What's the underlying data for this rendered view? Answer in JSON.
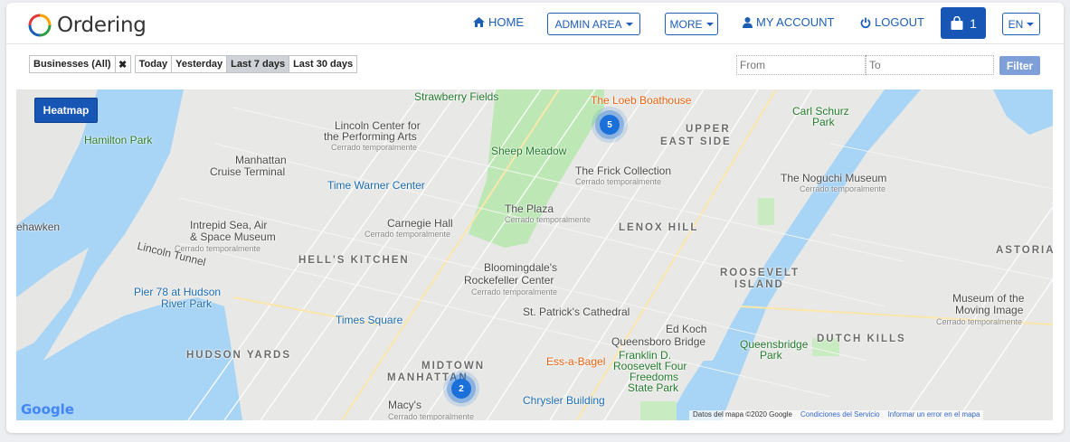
{
  "app": {
    "name": "Ordering"
  },
  "nav": {
    "home": "HOME",
    "admin": "ADMIN AREA",
    "more": "MORE",
    "account": "MY ACCOUNT",
    "logout": "LOGOUT",
    "cart_count": "1",
    "lang": "EN"
  },
  "filters": {
    "businesses": "Businesses (All)",
    "clear": "✖",
    "ranges": [
      "Today",
      "Yesterday",
      "Last 7 days",
      "Last 30 days"
    ],
    "active_range": "Last 7 days",
    "from_placeholder": "From",
    "to_placeholder": "To",
    "filter_button": "Filter"
  },
  "map": {
    "heatmap_button": "Heatmap",
    "clusters": [
      {
        "label": "5"
      },
      {
        "label": "2"
      }
    ],
    "labels": {
      "strawberry": "Strawberry Fields",
      "loeb": "The Loeb Boathouse",
      "carl": "Carl Schurz",
      "carl2": "Park",
      "upper": "UPPER",
      "eastside": "EAST SIDE",
      "lincoln1": "Lincoln Center for",
      "lincoln2": "the Performing Arts",
      "lincoln_sub": "Cerrado temporalmente",
      "hamilton": "Hamilton Park",
      "manhattan_cruise1": "Manhattan",
      "manhattan_cruise2": "Cruise Terminal",
      "sheep": "Sheep Meadow",
      "frick": "The Frick Collection",
      "frick_sub": "Cerrado temporalmente",
      "noguchi": "The Noguchi Museum",
      "noguchi_sub": "Cerrado temporalmente",
      "timewarner": "Time Warner Center",
      "plaza": "The Plaza",
      "plaza_sub": "Cerrado temporalmente",
      "lenox": "LENOX HILL",
      "weehawken": "ehawken",
      "intrepid1": "Intrepid Sea, Air",
      "intrepid2": "& Space Museum",
      "intrepid_sub": "Cerrado temporalmente",
      "carnegie": "Carnegie Hall",
      "carnegie_sub": "Cerrado temporalmente",
      "astoria": "ASTORIA",
      "hells": "HELL'S KITCHEN",
      "lincoln_tunnel": "Lincoln Tunnel",
      "bloomingdales": "Bloomingdale's",
      "roosevelt1": "ROOSEVELT",
      "roosevelt2": "ISLAND",
      "rockefeller": "Rockefeller Center",
      "rockefeller_sub": "Cerrado temporalmente",
      "pier78a": "Pier 78 at Hudson",
      "pier78b": "River Park",
      "stpatricks": "St. Patrick's Cathedral",
      "museum_moving1": "Museum of the",
      "museum_moving2": "Moving Image",
      "museum_moving_sub": "Cerrado temporalmente",
      "times": "Times Square",
      "edkoch1": "Ed Koch",
      "edkoch2": "Queensboro Bridge",
      "queensbridge1": "Queensbridge",
      "queensbridge2": "Park",
      "dutch": "DUTCH KILLS",
      "hudson_yards": "HUDSON YARDS",
      "midtown1": "MIDTOWN",
      "midtown2": "MANHATTAN",
      "essabagel": "Ess-a-Bagel",
      "franklin1": "Franklin D.",
      "franklin2": "Roosevelt Four",
      "franklin3": "Freedoms",
      "franklin4": "State Park",
      "chrysler": "Chrysler Building",
      "macys": "Macy's",
      "macys_sub": "Cerrado temporalmente"
    },
    "google": "Google",
    "attribution": {
      "data": "Datos del mapa ©2020 Google",
      "terms": "Condiciones del Servicio",
      "report": "Informar un error en el mapa"
    }
  },
  "colors": {
    "brand": "#1756b5",
    "nav_text": "#1c5db5",
    "water": "#a8d4f5",
    "park": "#bde8b6",
    "marker": "#1a6fd9"
  }
}
